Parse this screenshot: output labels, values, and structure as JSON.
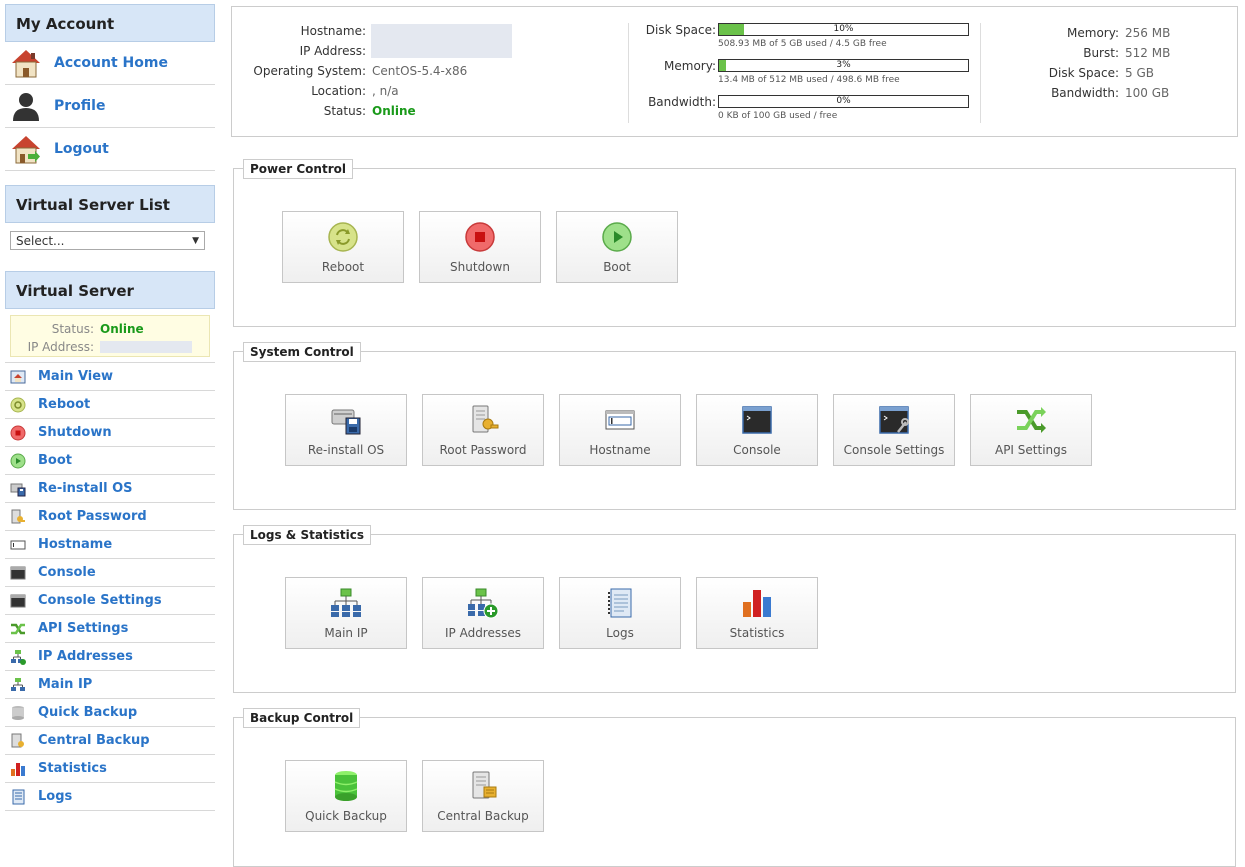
{
  "sidebar": {
    "my_account": {
      "title": "My Account",
      "items": [
        {
          "label": "Account Home",
          "icon": "house-icon"
        },
        {
          "label": "Profile",
          "icon": "person-icon"
        },
        {
          "label": "Logout",
          "icon": "house-exit-icon"
        }
      ]
    },
    "server_list": {
      "title": "Virtual Server List",
      "select_value": "Select..."
    },
    "virtual_server": {
      "title": "Virtual Server",
      "status_label": "Status:",
      "status_value": "Online",
      "ip_label": "IP Address:",
      "items": [
        {
          "label": "Main View",
          "icon": "main-view-icon"
        },
        {
          "label": "Reboot",
          "icon": "reboot-icon"
        },
        {
          "label": "Shutdown",
          "icon": "shutdown-icon"
        },
        {
          "label": "Boot",
          "icon": "boot-icon"
        },
        {
          "label": "Re-install OS",
          "icon": "reinstall-icon"
        },
        {
          "label": "Root Password",
          "icon": "key-icon"
        },
        {
          "label": "Hostname",
          "icon": "hostname-icon"
        },
        {
          "label": "Console",
          "icon": "console-icon"
        },
        {
          "label": "Console Settings",
          "icon": "console-settings-icon"
        },
        {
          "label": "API Settings",
          "icon": "api-icon"
        },
        {
          "label": "IP Addresses",
          "icon": "ip-addresses-icon"
        },
        {
          "label": "Main IP",
          "icon": "main-ip-icon"
        },
        {
          "label": "Quick Backup",
          "icon": "database-icon"
        },
        {
          "label": "Central Backup",
          "icon": "central-backup-icon"
        },
        {
          "label": "Statistics",
          "icon": "statistics-icon"
        },
        {
          "label": "Logs",
          "icon": "logs-icon"
        }
      ]
    }
  },
  "info": {
    "hostname_label": "Hostname:",
    "ip_label": "IP Address:",
    "os_label": "Operating System:",
    "os_value": "CentOS-5.4-x86",
    "location_label": "Location:",
    "location_value": ", n/a",
    "status_label": "Status:",
    "status_value": "Online",
    "usage": [
      {
        "label": "Disk Space:",
        "percent": 10,
        "percent_text": "10%",
        "detail": "508.93 MB of 5 GB used / 4.5 GB free"
      },
      {
        "label": "Memory:",
        "percent": 3,
        "percent_text": "3%",
        "detail": "13.4 MB of 512 MB used / 498.6 MB free"
      },
      {
        "label": "Bandwidth:",
        "percent": 0,
        "percent_text": "0%",
        "detail": "0 KB of 100 GB used / free"
      }
    ],
    "limits": [
      {
        "label": "Memory:",
        "value": "256 MB"
      },
      {
        "label": "Burst:",
        "value": "512 MB"
      },
      {
        "label": "Disk Space:",
        "value": "5 GB"
      },
      {
        "label": "Bandwidth:",
        "value": "100 GB"
      }
    ]
  },
  "sections": [
    {
      "title": "Power Control",
      "tiles": [
        {
          "label": "Reboot",
          "icon": "reboot-icon"
        },
        {
          "label": "Shutdown",
          "icon": "shutdown-icon"
        },
        {
          "label": "Boot",
          "icon": "boot-icon"
        }
      ]
    },
    {
      "title": "System Control",
      "tiles": [
        {
          "label": "Re-install OS",
          "icon": "reinstall-icon"
        },
        {
          "label": "Root Password",
          "icon": "key-icon"
        },
        {
          "label": "Hostname",
          "icon": "hostname-icon"
        },
        {
          "label": "Console",
          "icon": "console-icon"
        },
        {
          "label": "Console Settings",
          "icon": "console-settings-icon"
        },
        {
          "label": "API Settings",
          "icon": "api-icon"
        }
      ]
    },
    {
      "title": "Logs & Statistics",
      "tiles": [
        {
          "label": "Main IP",
          "icon": "main-ip-icon"
        },
        {
          "label": "IP Addresses",
          "icon": "ip-addresses-icon"
        },
        {
          "label": "Logs",
          "icon": "logs-icon"
        },
        {
          "label": "Statistics",
          "icon": "statistics-icon"
        }
      ]
    },
    {
      "title": "Backup Control",
      "tiles": [
        {
          "label": "Quick Backup",
          "icon": "database-icon"
        },
        {
          "label": "Central Backup",
          "icon": "central-backup-icon"
        }
      ]
    }
  ],
  "colors": {
    "link": "#2a74c8",
    "online": "#1a9a1a",
    "bar_fill": "#6bc24a",
    "header_bg": "#d7e6f7"
  }
}
